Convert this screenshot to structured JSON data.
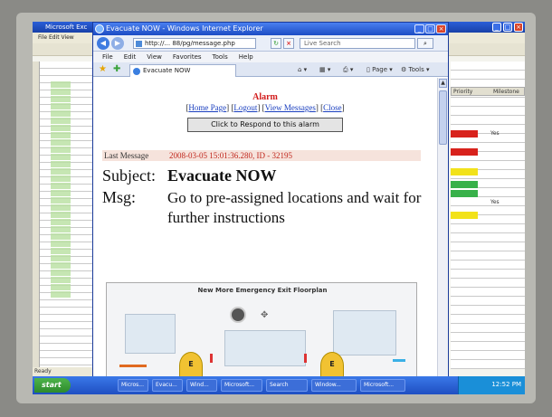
{
  "excel": {
    "title": "Microsoft Exc",
    "menu": "File Edit View",
    "status": "Ready",
    "col_hdr_a": "Priority",
    "col_hdr_b": "Milestone",
    "cell_yes_1": "Yes",
    "cell_yes_2": "Yes"
  },
  "ie": {
    "title": "Evacuate NOW - Windows Internet Explorer",
    "address": "http://... 88/pg/message.php",
    "search_placeholder": "Live Search",
    "menu": [
      "File",
      "Edit",
      "View",
      "Favorites",
      "Tools",
      "Help"
    ],
    "tab_label": "Evacuate NOW",
    "cmd_page": "Page",
    "cmd_tools": "Tools"
  },
  "page": {
    "alarm_title": "Alarm",
    "links": [
      "Home Page",
      "Logout",
      "View Messages",
      "Close"
    ],
    "respond_button": "Click to Respond to this alarm",
    "last_message_label": "Last Message",
    "last_message_value": "2008-03-05 15:01:36.280, ID - 32195",
    "subject_label": "Subject:",
    "subject_value": "Evacuate NOW",
    "msg_label": "Msg:",
    "msg_value": "Go to pre-assigned locations and wait for further instructions",
    "floorplan_title": "New More Emergency Exit Floorplan",
    "exit_label": "E"
  },
  "taskbar": {
    "start": "start",
    "tasks": [
      "Micros...",
      "Evacu...",
      "Wind...",
      "Microsoft...",
      "Search",
      "Window...",
      "Microsoft..."
    ],
    "clock": "12:52 PM"
  }
}
